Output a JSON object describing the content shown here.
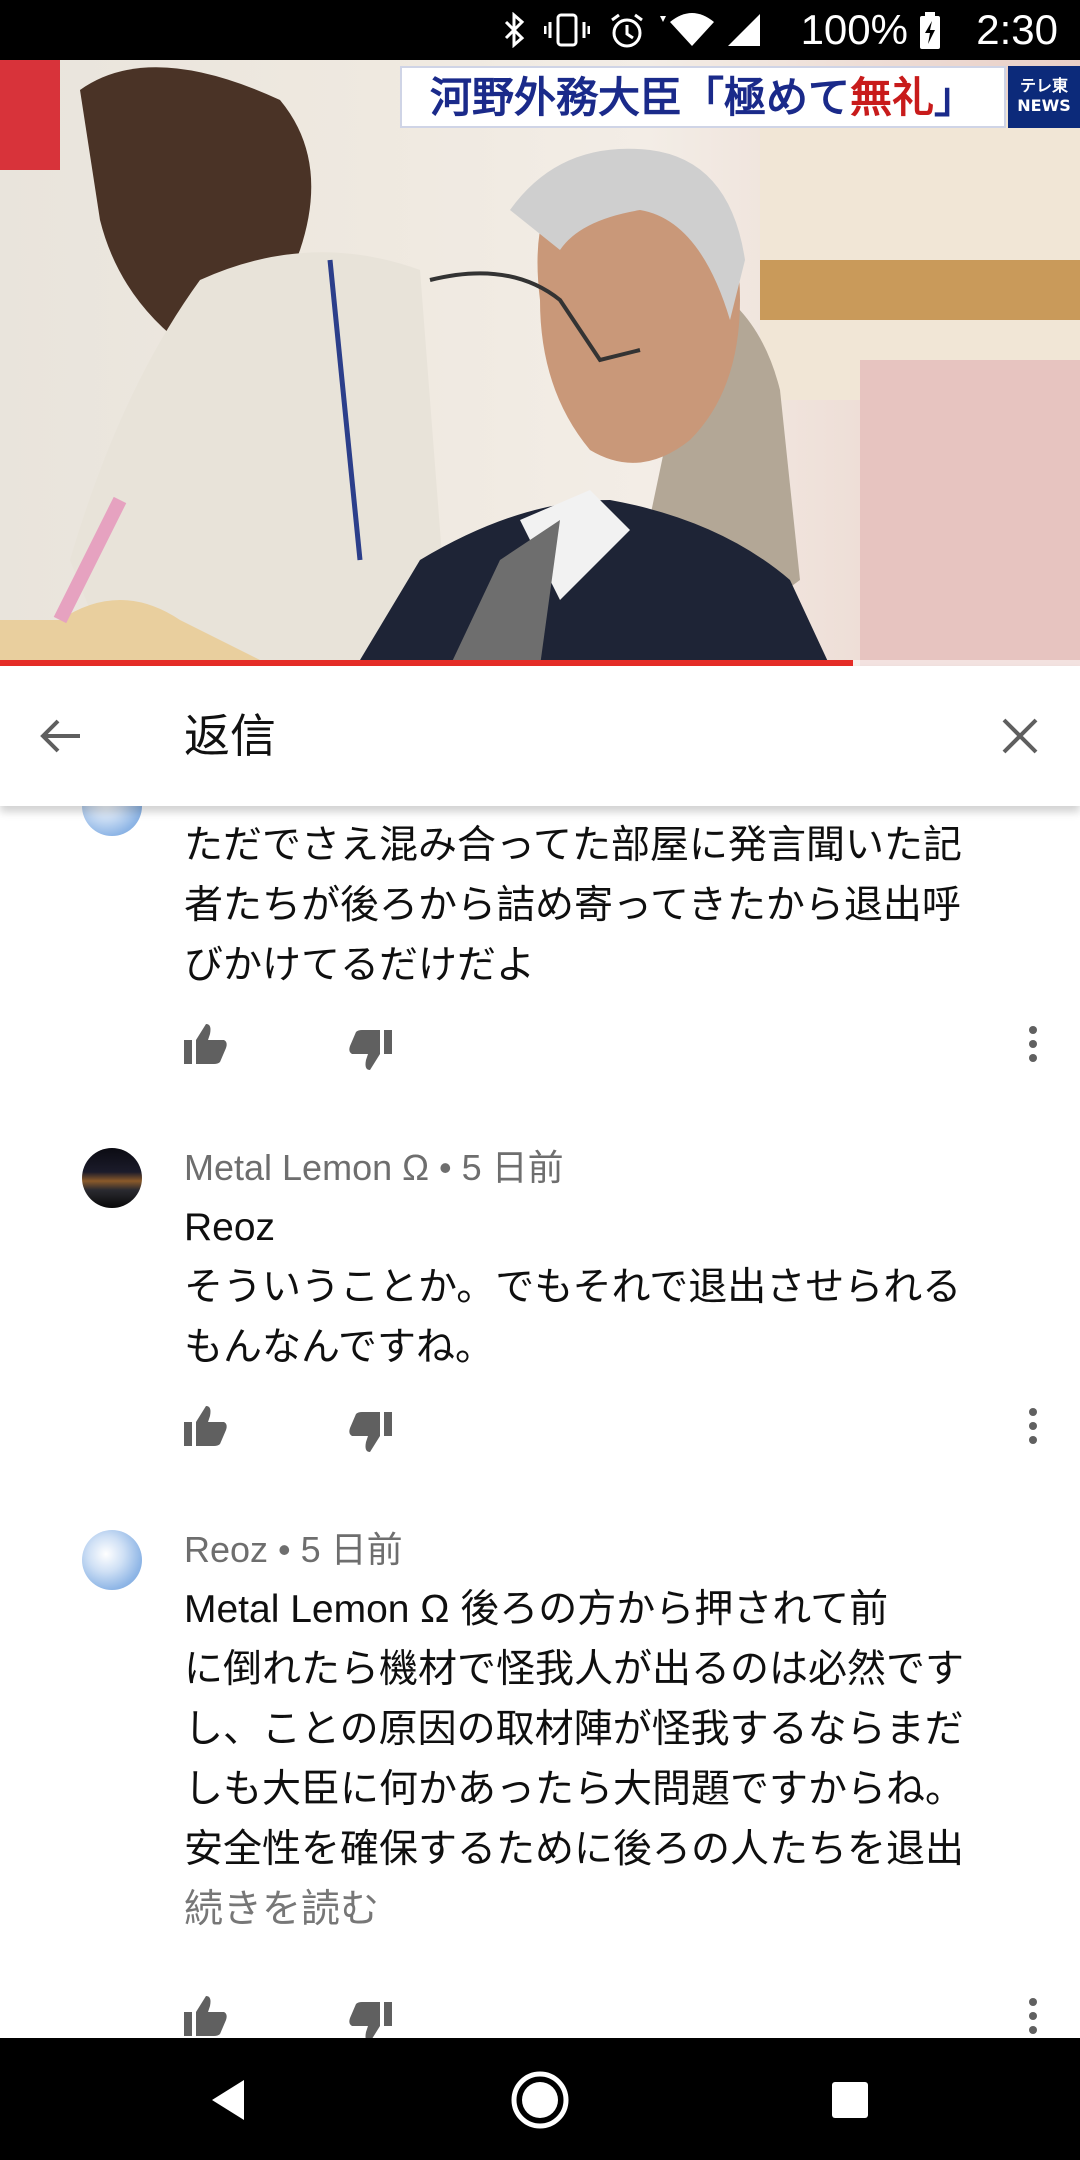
{
  "status_bar": {
    "battery_percent": "100%",
    "time": "2:30",
    "icons": [
      "bluetooth-icon",
      "vibrate-icon",
      "alarm-icon",
      "wifi-icon",
      "signal-icon",
      "battery-charging-icon"
    ]
  },
  "video": {
    "caption_part1": "河野外務大臣「極めて",
    "caption_part2": "無礼",
    "caption_part3": "」",
    "logo_line1": "テレ東",
    "logo_line2": "NEWS",
    "progress_fraction": 0.79,
    "progress_color": "#e52d27"
  },
  "header": {
    "title": "返信",
    "back_icon": "arrow-left-icon",
    "close_icon": "close-icon"
  },
  "comments": [
    {
      "text_lines": [
        "ただでさえ混み合ってた部屋に発言聞いた記",
        "者たちが後ろから詰め寄ってきたから退出呼",
        "びかけてるだけだよ"
      ]
    },
    {
      "author": "Metal Lemon Ω",
      "time": "5 日前",
      "reply_to": "Reoz",
      "text_lines": [
        "そういうことか。でもそれで退出させられる",
        "もんなんですね。"
      ]
    },
    {
      "author": "Reoz",
      "time": "5 日前",
      "text_lines": [
        "Metal Lemon Ω 後ろの方から押されて前",
        "に倒れたら機材で怪我人が出るのは必然です",
        "し、ことの原因の取材陣が怪我するならまだ",
        "しも大臣に何かあったら大問題ですからね。",
        "安全性を確保するために後ろの人たちを退出"
      ],
      "read_more": "続きを読む"
    }
  ]
}
